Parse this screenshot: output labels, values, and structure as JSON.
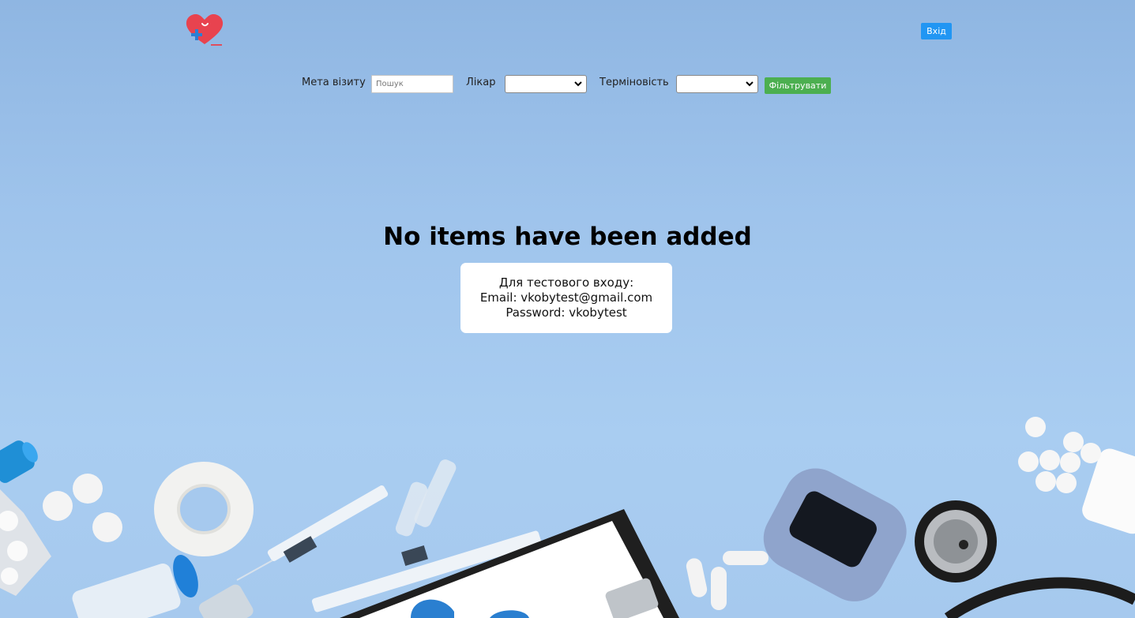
{
  "header": {
    "logo_name": "heart-plus-logo",
    "login_label": "Вхід"
  },
  "filters": {
    "purpose_label": "Мета візиту",
    "search_placeholder": "Пошук",
    "doctor_label": "Лікар",
    "doctor_selected": "",
    "urgency_label": "Терміновість",
    "urgency_selected": "",
    "filter_button_label": "Фільтрувати"
  },
  "main": {
    "empty_title": "No items have been added",
    "test_login": {
      "line1": "Для тестового входу:",
      "line2": "Email: vkobytest@gmail.com",
      "line3": "Password: vkobytest"
    }
  },
  "colors": {
    "background": "#a2c6ee",
    "login_button": "#2196f3",
    "filter_button": "#4caf50",
    "logo_heart": "#e8434f",
    "logo_plus": "#2b7fd4"
  }
}
